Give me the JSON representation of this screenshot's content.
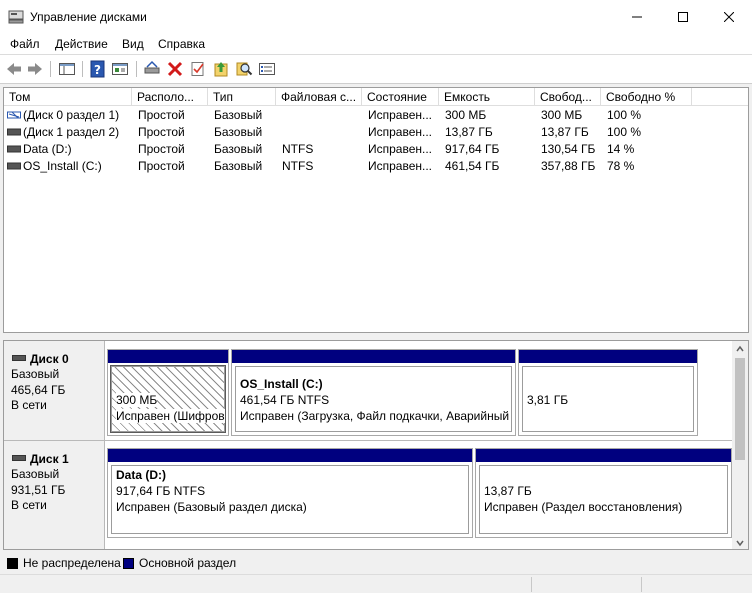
{
  "window": {
    "title": "Управление дисками"
  },
  "menu": [
    "Файл",
    "Действие",
    "Вид",
    "Справка"
  ],
  "toolbar": {
    "icons": [
      "back-arrow-icon",
      "forward-arrow-icon",
      "show-pane-icon",
      "help-icon",
      "properties-icon",
      "connect-disk-icon",
      "delete-icon",
      "check-icon",
      "import-icon",
      "search-icon",
      "list-icon"
    ]
  },
  "volumes_table": {
    "columns": [
      "Том",
      "Располо...",
      "Тип",
      "Файловая с...",
      "Состояние",
      "Емкость",
      "Свобод...",
      "Свободно %"
    ],
    "rows": [
      {
        "volume": "(Диск 0 раздел 1)",
        "layout": "Простой",
        "type": "Базовый",
        "fs": "",
        "status": "Исправен...",
        "capacity": "300 МБ",
        "free": "300 МБ",
        "free_pct": "100 %"
      },
      {
        "volume": "(Диск 1 раздел 2)",
        "layout": "Простой",
        "type": "Базовый",
        "fs": "",
        "status": "Исправен...",
        "capacity": "13,87 ГБ",
        "free": "13,87 ГБ",
        "free_pct": "100 %"
      },
      {
        "volume": "Data (D:)",
        "layout": "Простой",
        "type": "Базовый",
        "fs": "NTFS",
        "status": "Исправен...",
        "capacity": "917,64 ГБ",
        "free": "130,54 ГБ",
        "free_pct": "14 %"
      },
      {
        "volume": "OS_Install (C:)",
        "layout": "Простой",
        "type": "Базовый",
        "fs": "NTFS",
        "status": "Исправен...",
        "capacity": "461,54 ГБ",
        "free": "357,88 ГБ",
        "free_pct": "78 %"
      }
    ]
  },
  "disks": [
    {
      "name": "Диск 0",
      "type": "Базовый",
      "size": "465,64 ГБ",
      "state": "В сети",
      "partitions": [
        {
          "label": "",
          "size": "300 МБ",
          "status": "Исправен (Шифров"
        },
        {
          "label": "OS_Install  (C:)",
          "size": "461,54 ГБ NTFS",
          "status": "Исправен (Загрузка, Файл подкачки, Аварийный"
        },
        {
          "label": "",
          "size": "3,81 ГБ",
          "status": ""
        }
      ]
    },
    {
      "name": "Диск 1",
      "type": "Базовый",
      "size": "931,51 ГБ",
      "state": "В сети",
      "partitions": [
        {
          "label": "Data  (D:)",
          "size": "917,64 ГБ NTFS",
          "status": "Исправен (Базовый раздел диска)"
        },
        {
          "label": "",
          "size": "13,87 ГБ",
          "status": "Исправен (Раздел восстановления)"
        }
      ]
    }
  ],
  "legend": [
    {
      "label": "Не распределена",
      "color": "#000000"
    },
    {
      "label": "Основной раздел",
      "color": "#00007f"
    }
  ],
  "colors": {
    "primary_partition": "#00007f",
    "unallocated": "#000000"
  }
}
